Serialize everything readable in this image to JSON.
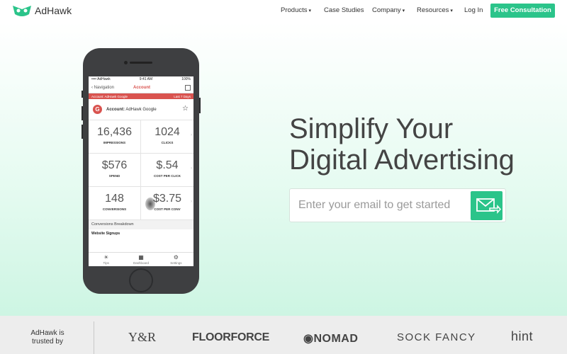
{
  "brand": {
    "name": "AdHawk",
    "accent": "#2bc48a"
  },
  "nav": {
    "items": [
      {
        "label": "Products",
        "caret": "▾"
      },
      {
        "label": "Case Studies",
        "caret": ""
      },
      {
        "label": "Company",
        "caret": "▾"
      },
      {
        "label": "Resources",
        "caret": "▾"
      },
      {
        "label": "Log In",
        "caret": ""
      }
    ],
    "cta": "Free Consultation"
  },
  "hero": {
    "headline_line1": "Simplify Your",
    "headline_line2": "Digital Advertising",
    "email_placeholder": "Enter your email to get started"
  },
  "phone": {
    "status": {
      "carrier": "•••• AdHawk",
      "time": "9:41 AM",
      "battery": "100%"
    },
    "nav_back": "Navigation",
    "nav_title": "Account",
    "bar_account": "Account: AdHawk Google",
    "bar_range": "Last 7 Days",
    "account_label": "Account:",
    "account_name": "AdHawk Google",
    "metrics": [
      {
        "value": "16,436",
        "label": "IMPRESSIONS"
      },
      {
        "value": "1024",
        "label": "CLICKS"
      },
      {
        "value": "$576",
        "label": "SPEND"
      },
      {
        "value": "$.54",
        "label": "COST PER CLICK"
      },
      {
        "value": "148",
        "label": "CONVERSIONS"
      },
      {
        "value": "$3.75",
        "label": "COST PER CONV"
      }
    ],
    "breakdown": "Conversions Breakdown",
    "signups": "Website Signups",
    "tabs": [
      "Tips",
      "Dashboard",
      "Settings"
    ]
  },
  "trusted": {
    "label": "AdHawk is trusted by",
    "logos": [
      "Y&R",
      "FLOORFORCE",
      "NOMAD",
      "SOCK FANCY",
      "hint"
    ]
  }
}
